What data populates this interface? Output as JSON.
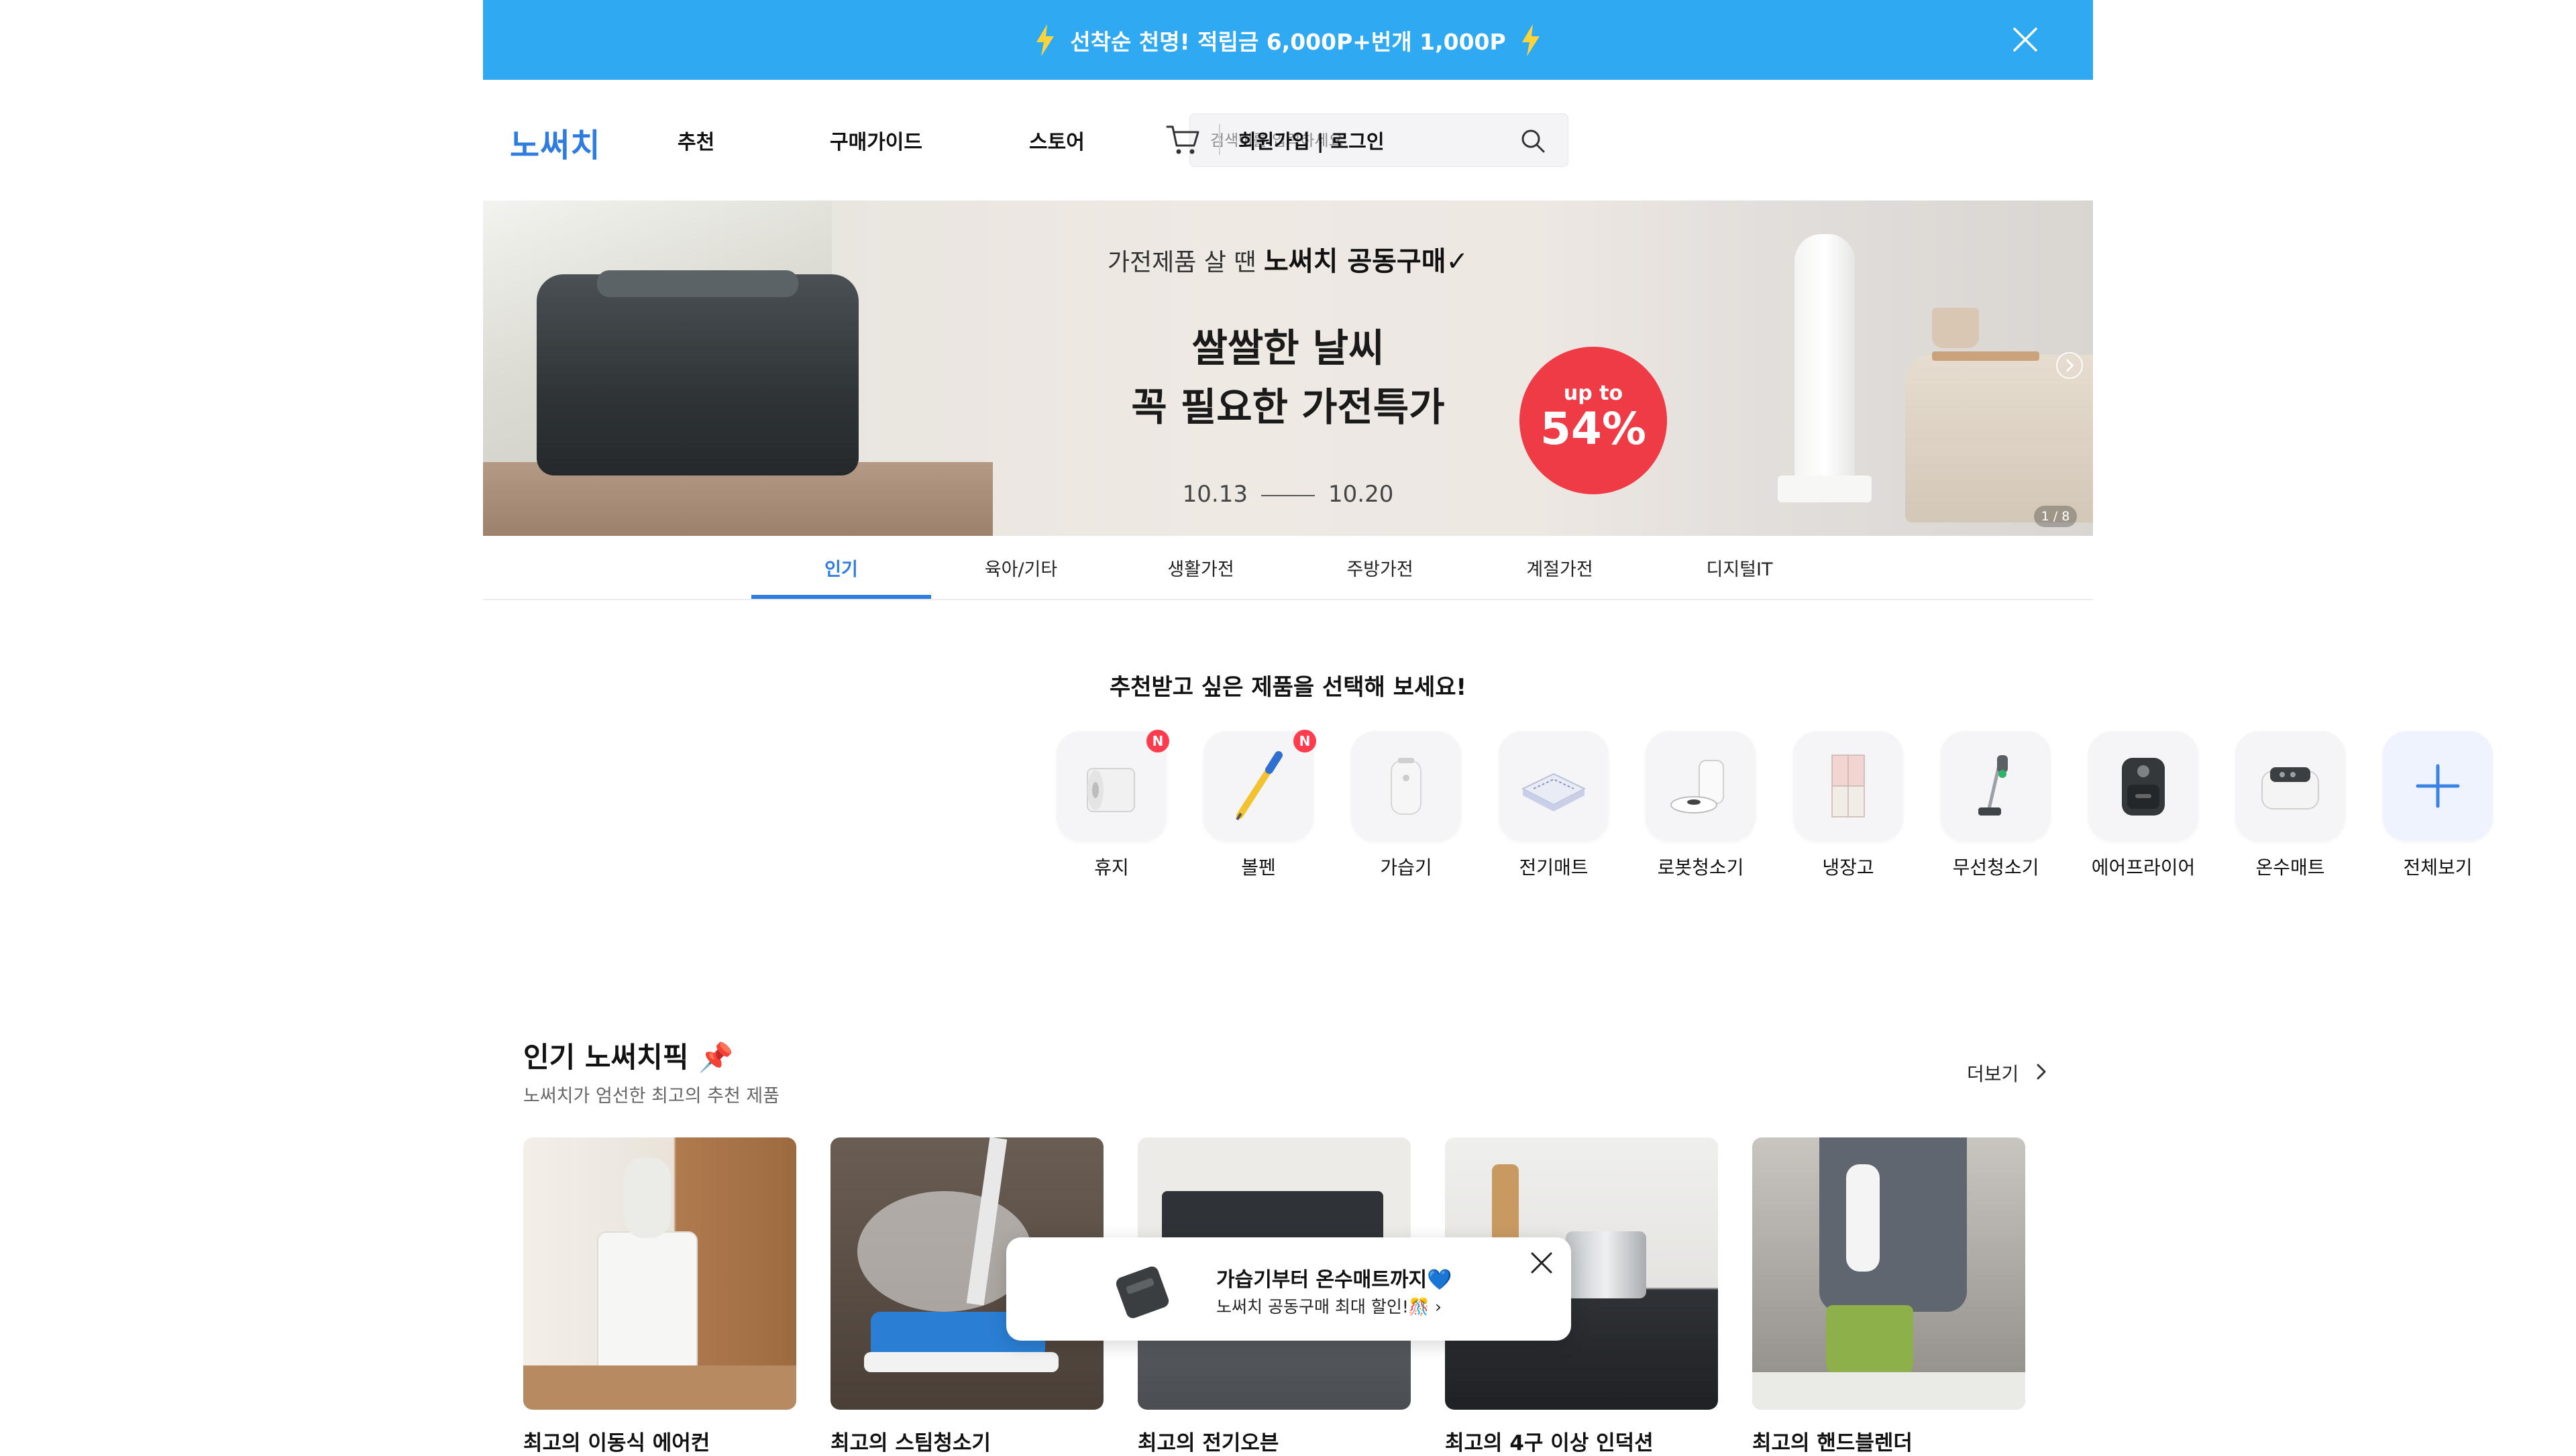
{
  "promo": {
    "text": "선착순 천명! 적립금 6,000P+번개 1,000P"
  },
  "header": {
    "logo": "노써치",
    "nav": [
      "추천",
      "구매가이드",
      "스토어"
    ],
    "search_placeholder": "검색어를 입력하세요",
    "auth": "회원가입 | 로그인"
  },
  "hero": {
    "subtitle_prefix": "가전제품 살 땐",
    "subtitle_brand": "노써치 공동구매✓",
    "headline_line1": "쌀쌀한 날씨",
    "headline_line2": "꼭 필요한 가전특가",
    "badge_top": "up to",
    "badge_value": "54%",
    "date_start": "10.13",
    "date_end": "10.20",
    "counter": "1 / 8"
  },
  "tabs": [
    "인기",
    "육아/기타",
    "생활가전",
    "주방가전",
    "계절가전",
    "디지털IT"
  ],
  "recommend": {
    "title": "추천받고 싶은 제품을 선택해 보세요!",
    "new_badge": "N",
    "categories": [
      {
        "label": "휴지",
        "icon": "tissue-icon",
        "new": true
      },
      {
        "label": "볼펜",
        "icon": "pen-icon",
        "new": true
      },
      {
        "label": "가습기",
        "icon": "humidifier-icon",
        "new": false
      },
      {
        "label": "전기매트",
        "icon": "electric-mat-icon",
        "new": false
      },
      {
        "label": "로봇청소기",
        "icon": "robot-vacuum-icon",
        "new": false
      },
      {
        "label": "냉장고",
        "icon": "refrigerator-icon",
        "new": false
      },
      {
        "label": "무선청소기",
        "icon": "cordless-vacuum-icon",
        "new": false
      },
      {
        "label": "에어프라이어",
        "icon": "air-fryer-icon",
        "new": false
      },
      {
        "label": "온수매트",
        "icon": "water-mat-icon",
        "new": false
      },
      {
        "label": "전체보기",
        "icon": "plus-icon",
        "new": false
      }
    ]
  },
  "popular": {
    "title": "인기 노써치픽 📌",
    "subtitle": "노써치가 엄선한 최고의 추천 제품",
    "more": "더보기",
    "cards": [
      {
        "title": "최고의 이동식 에어컨"
      },
      {
        "title": "최고의 스팀청소기"
      },
      {
        "title": "최고의 전기오븐"
      },
      {
        "title": "최고의 4구 이상 인덕션"
      },
      {
        "title": "최고의 핸드블렌더"
      }
    ]
  },
  "popup": {
    "line1": "가습기부터 온수매트까지💙",
    "line2": "노써치 공동구매 최대 할인!🎊"
  },
  "colors": {
    "accent": "#2f7ce0",
    "promo_bg": "#2fa9f2",
    "badge_red": "#ef3b46",
    "new_red": "#ff3b4e"
  }
}
